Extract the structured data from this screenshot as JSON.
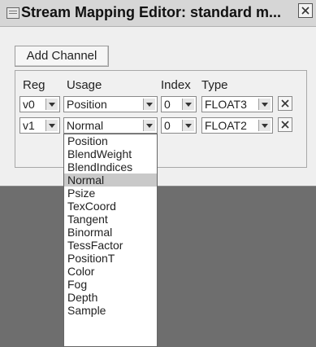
{
  "window": {
    "title": "Stream Mapping Editor: standard m...",
    "add_button": "Add Channel"
  },
  "headers": {
    "reg": "Reg",
    "usage": "Usage",
    "index": "Index",
    "type": "Type"
  },
  "rows": [
    {
      "reg": "v0",
      "usage": "Position",
      "index": "0",
      "type": "FLOAT3"
    },
    {
      "reg": "v1",
      "usage": "Normal",
      "index": "0",
      "type": "FLOAT2"
    }
  ],
  "dropdown": {
    "selected": "Normal",
    "options": [
      "Position",
      "BlendWeight",
      "BlendIndices",
      "Normal",
      "Psize",
      "TexCoord",
      "Tangent",
      "Binormal",
      "TessFactor",
      "PositionT",
      "Color",
      "Fog",
      "Depth",
      "Sample"
    ]
  }
}
